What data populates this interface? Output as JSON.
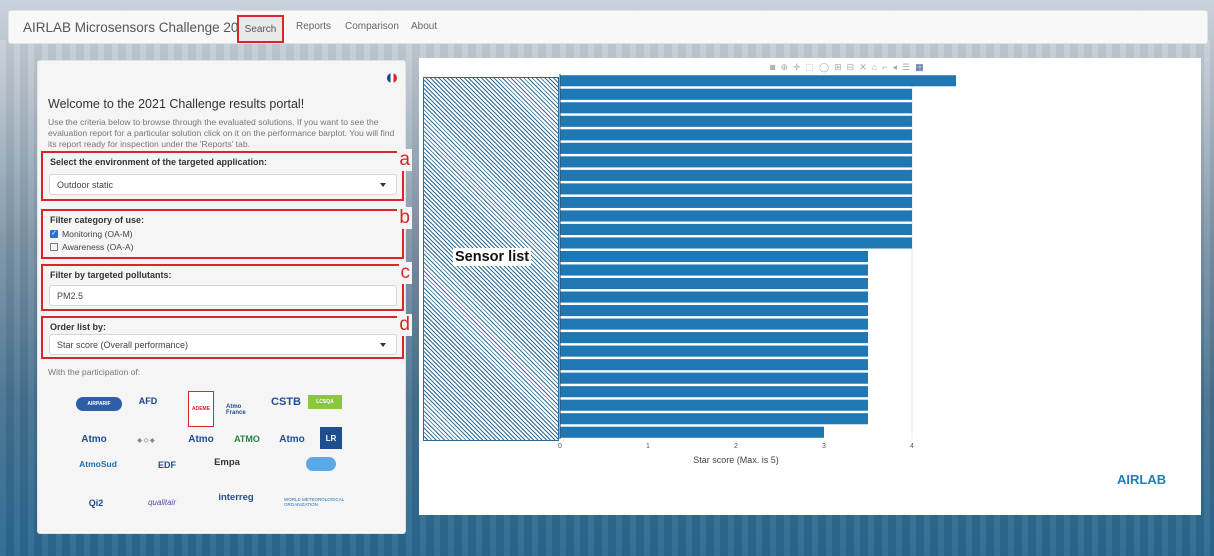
{
  "navbar": {
    "brand": "AIRLAB Microsensors Challenge 2021",
    "items": [
      "Search",
      "Reports",
      "Comparison",
      "About"
    ]
  },
  "panel": {
    "welcome_title": "Welcome to the 2021 Challenge results portal!",
    "intro": "Use the criteria below to browse through the evaluated solutions. If you want to see the evaluation report for a particular solution click on it on the performance barplot. You will find its report ready for inspection under the 'Reports' tab.",
    "environment": {
      "label": "Select the environment of the targeted application:",
      "value": "Outdoor static",
      "annotation": "a"
    },
    "category": {
      "label": "Filter category of use:",
      "options": [
        {
          "label": "Monitoring (OA-M)",
          "checked": true
        },
        {
          "label": "Awareness (OA-A)",
          "checked": false
        }
      ],
      "annotation": "b"
    },
    "pollutants": {
      "label": "Filter by targeted pollutants:",
      "value": "PM2.5",
      "annotation": "c"
    },
    "order": {
      "label": "Order list by:",
      "value": "Star score (Overall performance)",
      "annotation": "d"
    },
    "participation_label": "With the participation of:",
    "logos": [
      "AIRPARIF",
      "AFD",
      "ADEME",
      "Atmo France",
      "CSTB",
      "Atmo",
      "LCSQA",
      "Atmo",
      "ATMO",
      "Atmo",
      "LR",
      "AtmoSud",
      "EDF",
      "Empa",
      "Qi2",
      "qualitair",
      "interreg",
      "WORLD METEOROLOGICAL ORGANIZATION"
    ]
  },
  "chart": {
    "sensor_list_label": "Sensor list",
    "toolbar_icons": [
      "camera-icon",
      "zoom-icon",
      "pan-icon",
      "box-select-icon",
      "lasso-icon",
      "zoom-in-icon",
      "zoom-out-icon",
      "autoscale-icon",
      "home-icon",
      "spike-icon",
      "hover-closest-icon",
      "hover-compare-icon",
      "plotly-logo-icon"
    ],
    "brand_logo": "AIRLAB",
    "bar_color": "#1f77b4"
  },
  "chart_data": {
    "type": "bar",
    "orientation": "horizontal",
    "xlabel": "Star score (Max. is 5)",
    "xlim": [
      0,
      4.5
    ],
    "xticks": [
      0,
      1,
      2,
      3,
      4
    ],
    "values": [
      4.5,
      4,
      4,
      4,
      4,
      4,
      4,
      4,
      4,
      4,
      4,
      4,
      4,
      3.5,
      3.5,
      3.5,
      3.5,
      3.5,
      3.5,
      3.5,
      3.5,
      3.5,
      3.5,
      3.5,
      3.5,
      3.5,
      3
    ]
  }
}
